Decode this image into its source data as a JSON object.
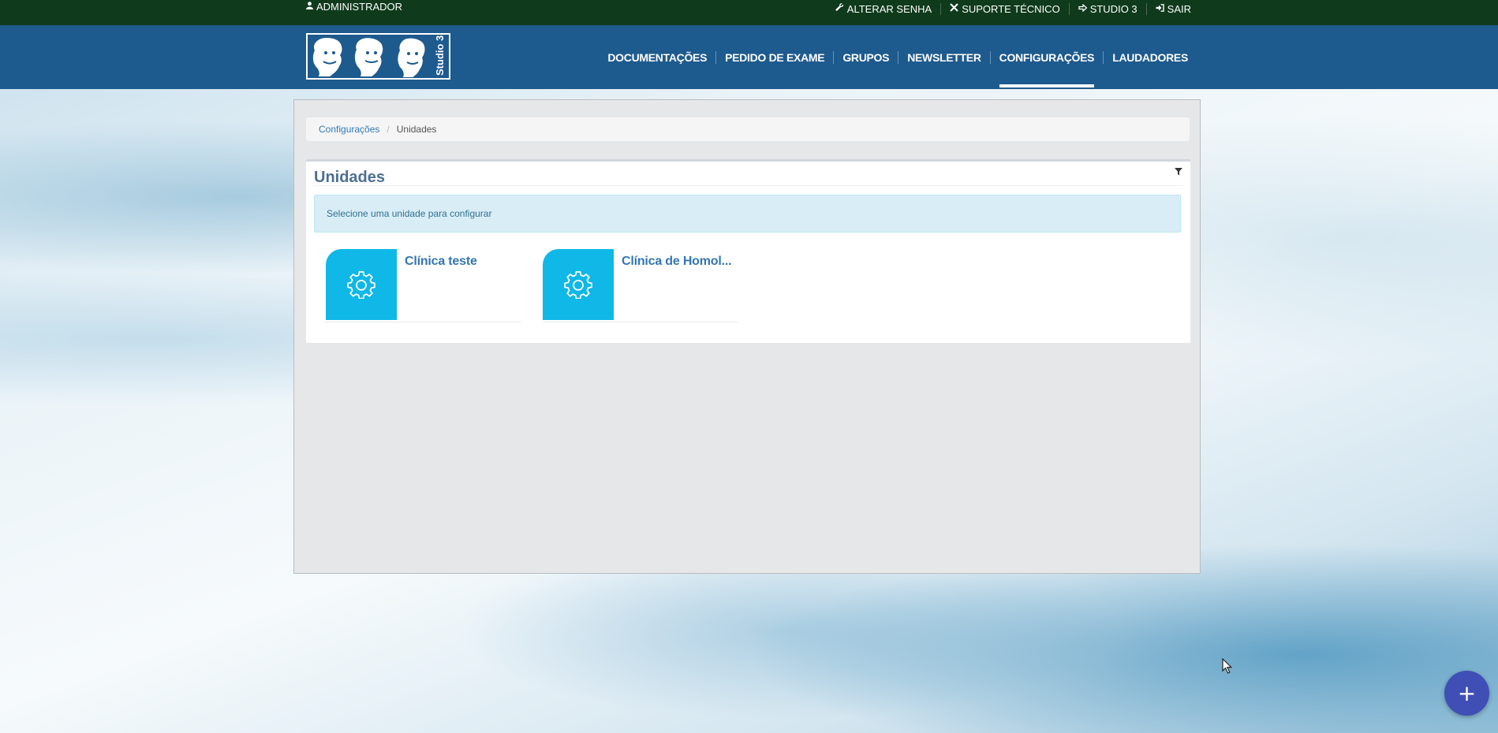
{
  "topbar": {
    "user_label": "ADMINISTRADOR",
    "links": [
      {
        "label": "ALTERAR SENHA",
        "icon": "wrench-icon"
      },
      {
        "label": "SUPORTE TÉCNICO",
        "icon": "tools-icon"
      },
      {
        "label": "STUDIO 3",
        "icon": "arrow-right-icon"
      },
      {
        "label": "SAIR",
        "icon": "sign-out-icon"
      }
    ]
  },
  "brand": {
    "logo_text": "Studio 3"
  },
  "nav": {
    "items": [
      {
        "label": "DOCUMENTAÇÕES",
        "active": false
      },
      {
        "label": "PEDIDO DE EXAME",
        "active": false
      },
      {
        "label": "GRUPOS",
        "active": false
      },
      {
        "label": "NEWSLETTER",
        "active": false
      },
      {
        "label": "CONFIGURAÇÕES",
        "active": true
      },
      {
        "label": "LAUDADORES",
        "active": false
      }
    ]
  },
  "breadcrumb": {
    "parent": "Configurações",
    "current": "Unidades"
  },
  "main": {
    "title": "Unidades",
    "alert": "Selecione uma unidade para configurar",
    "units": [
      {
        "name": "Clínica teste",
        "icon": "gear-icon"
      },
      {
        "name": "Clínica de Homol...",
        "icon": "gear-icon"
      }
    ]
  },
  "fab": {
    "label": "+"
  },
  "colors": {
    "topbar": "#0f3a1c",
    "navbar": "#1d5a8e",
    "accent_cyan": "#0fb8e7",
    "fab": "#3f4fb5",
    "link": "#337ab7"
  }
}
